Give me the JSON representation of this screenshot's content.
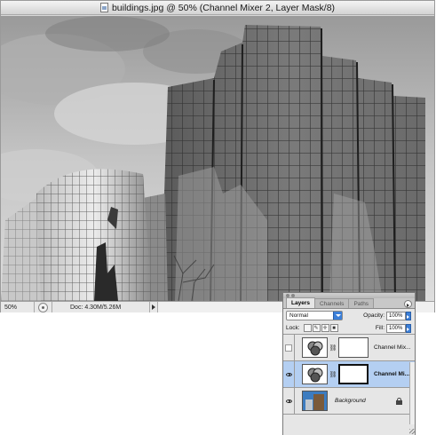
{
  "document": {
    "title": "buildings.jpg @ 50% (Channel Mixer 2, Layer Mask/8)",
    "zoom": "50%",
    "doc_size": "Doc: 4.30M/5.26M"
  },
  "layers_panel": {
    "tabs": [
      {
        "label": "Layers",
        "active": true
      },
      {
        "label": "Channels",
        "active": false
      },
      {
        "label": "Paths",
        "active": false
      }
    ],
    "blend_mode": "Normal",
    "opacity_label": "Opacity:",
    "opacity_value": "100%",
    "lock_label": "Lock:",
    "fill_label": "Fill:",
    "fill_value": "100%",
    "layers": [
      {
        "name": "Channel Mix...",
        "visible": false,
        "selected": false,
        "has_mask": true
      },
      {
        "name": "Channel Mi...",
        "visible": true,
        "selected": true,
        "has_mask": true
      },
      {
        "name": "Background",
        "visible": true,
        "selected": false,
        "has_mask": false,
        "locked": true
      }
    ],
    "selected_color": "#b4cff2"
  },
  "icons": {
    "titlebar": "document-icon",
    "status": "info-icon",
    "lock_options": [
      "lock-transparent-icon",
      "lock-image-icon",
      "lock-position-icon",
      "lock-all-icon"
    ],
    "bottom_buttons": [
      "link-layers-icon",
      "layer-style-icon",
      "add-mask-icon",
      "adjustment-layer-icon",
      "new-group-icon",
      "new-layer-icon",
      "trash-icon"
    ]
  }
}
